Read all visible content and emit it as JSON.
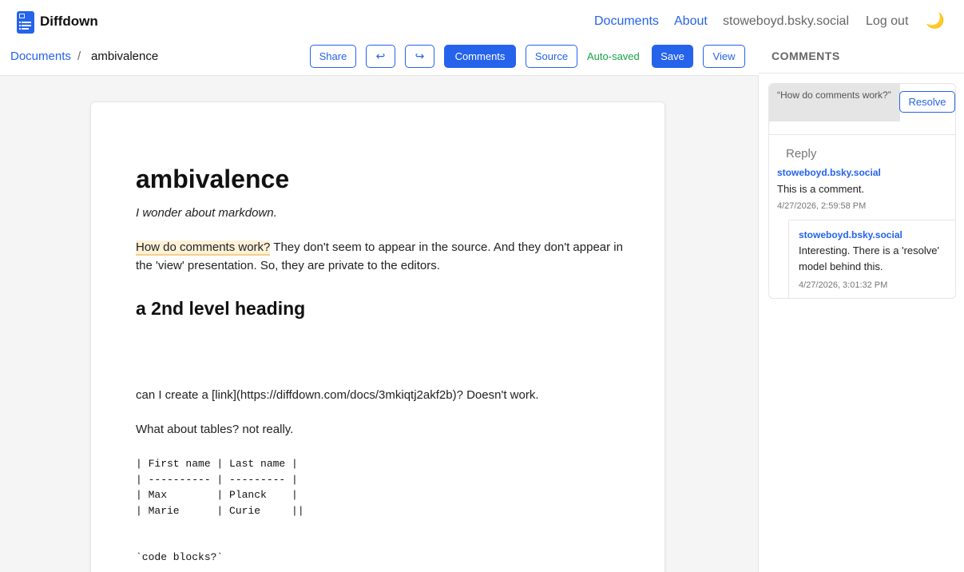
{
  "nav": {
    "brand": "Diffdown",
    "links": [
      "Documents",
      "About"
    ],
    "user": "stoweboyd.bsky.social",
    "logout": "Log out",
    "theme_icon": "🌙"
  },
  "toolbar": {
    "breadcrumb_root": "Documents",
    "breadcrumb_sep": "/",
    "breadcrumb_current": "ambivalence",
    "share_label": "Share",
    "undo_symbol": "↩",
    "redo_symbol": "↪",
    "comments_label": "Comments",
    "source_label": "Source",
    "autosave_status": "Auto-saved",
    "save_label": "Save",
    "view_label": "View"
  },
  "document": {
    "title": "ambivalence",
    "subtitle": "I wonder about markdown.",
    "para_highlight": "How do comments work?",
    "para_rest": " They don't seem to appear in the source. And they don't appear in the 'view' presentation. So, they are private to the editors.",
    "heading2": "a 2nd level heading",
    "link_line": "can I create a [link](https://diffdown.com/docs/3mkiqtj2akf2b)? Doesn't work.",
    "tables_line": "What about tables? not really.",
    "table_lines": [
      "| First name | Last name |",
      "| ---------- | --------- |",
      "| Max        | Planck    |",
      "| Marie      | Curie     ||"
    ],
    "code_line": "`code blocks?`"
  },
  "comments": {
    "title": "COMMENTS",
    "quote": "“How do comments work?”",
    "resolve_label": "Resolve",
    "reply_label": "Reply",
    "items": [
      {
        "author": "stoweboyd.bsky.social",
        "body": "This is a comment.",
        "time": "4/27/2026, 2:59:58 PM"
      },
      {
        "author": "stoweboyd.bsky.social",
        "body": "Interesting. There is a 'resolve' model behind this.",
        "time": "4/27/2026, 3:01:32 PM"
      }
    ]
  },
  "colors": {
    "accent": "#2563eb",
    "success": "#16a34a",
    "highlight": "#fdf1d8"
  }
}
